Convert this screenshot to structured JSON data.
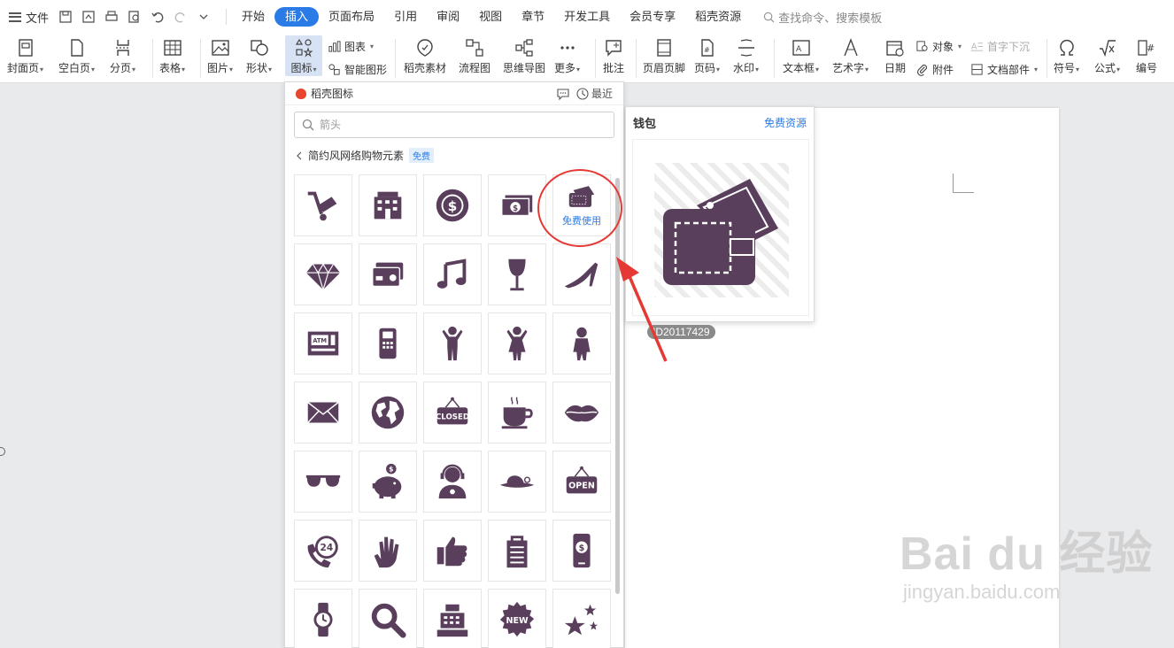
{
  "menubar": {
    "file_label": "文件",
    "tabs": [
      "开始",
      "插入",
      "页面布局",
      "引用",
      "审阅",
      "视图",
      "章节",
      "开发工具",
      "会员专享",
      "稻壳资源"
    ],
    "active_tab": "插入",
    "search_placeholder": "查找命令、搜索模板"
  },
  "ribbon": {
    "cover": "封面页",
    "blank": "空白页",
    "pagebreak": "分页",
    "table": "表格",
    "picture": "图片",
    "shape": "形状",
    "icon": "图标",
    "chart": "图表",
    "smartart": "智能图形",
    "material": "稻壳素材",
    "flowchart": "流程图",
    "mindmap": "思维导图",
    "more": "更多",
    "comment": "批注",
    "headerfooter": "页眉页脚",
    "pagenum": "页码",
    "watermark": "水印",
    "textbox": "文本框",
    "wordart": "艺术字",
    "date": "日期",
    "object": "对象",
    "dropcap": "首字下沉",
    "attachment": "附件",
    "docparts": "文档部件",
    "symbol": "符号",
    "formula": "公式",
    "numbering": "编号"
  },
  "icon_panel": {
    "title": "稻壳图标",
    "recent": "最近",
    "search_placeholder": "箭头",
    "breadcrumb": "简约风网络购物元素",
    "free_badge": "免费",
    "hover_label": "免费使用",
    "icons": [
      "cart",
      "store",
      "coin",
      "money",
      "wallet",
      "diamond",
      "credit-card",
      "music",
      "wine-glass",
      "high-heel",
      "atm",
      "pos-terminal",
      "man",
      "woman",
      "child",
      "mail",
      "globe",
      "closed-sign",
      "coffee",
      "lips",
      "sunglasses",
      "piggy-bank",
      "support-agent",
      "hat",
      "open-sign",
      "phone-24",
      "hand",
      "thumbs-up",
      "shopping-bag",
      "mobile-pay",
      "watch",
      "magnifier",
      "cash-register",
      "new-badge",
      "stars"
    ],
    "closed_text": "CLOSED",
    "open_text": "OPEN",
    "new_text": "NEW",
    "h24_text": "24"
  },
  "preview": {
    "name": "钱包",
    "link": "免费资源",
    "id": "ID20117429"
  },
  "colors": {
    "icon": "#5a3f5c",
    "accent": "#2b7be6",
    "annotation": "#e53935"
  },
  "watermark": {
    "logo": "Bai du 经验",
    "url": "jingyan.baidu.com"
  }
}
